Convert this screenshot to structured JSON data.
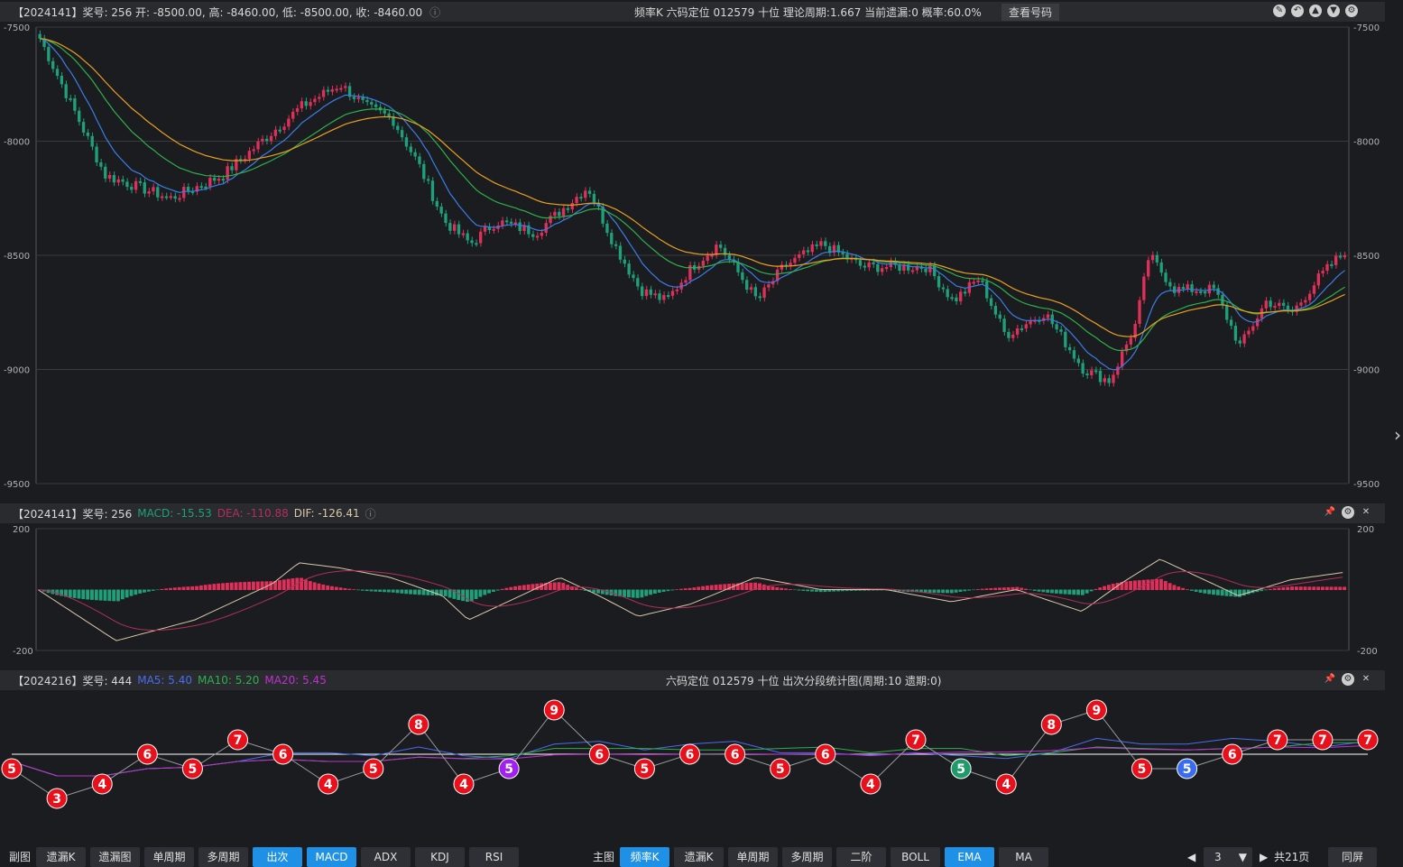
{
  "main_header": {
    "info": "【2024141】奖号: 256   开: -8500.00, 高: -8460.00, 低: -8500.00, 收: -8460.00",
    "center": "频率K   六码定位   012579   十位   理论周期:1.667   当前遗漏:0   概率:60.0%",
    "button": "查看号码"
  },
  "main_axis": {
    "labels": [
      "-7500",
      "-8000",
      "-8500",
      "-9000",
      "-9500"
    ]
  },
  "macd_header": {
    "prefix": "【2024141】奖号: 256",
    "macd": "MACD: -15.53",
    "dea": "DEA: -110.88",
    "dif": "DIF: -126.41"
  },
  "macd_axis": {
    "top": "200",
    "bottom": "-200"
  },
  "stat_header": {
    "prefix": "【2024216】奖号: 444",
    "ma5": "MA5: 5.40",
    "ma10": "MA10: 5.20",
    "ma20": "MA20: 5.45",
    "center": "六码定位   012579     十位   出次分段统计图(周期:10   遗期:0)"
  },
  "stat_points": [
    {
      "v": 5,
      "c": "red"
    },
    {
      "v": 3,
      "c": "red"
    },
    {
      "v": 4,
      "c": "red"
    },
    {
      "v": 6,
      "c": "red"
    },
    {
      "v": 5,
      "c": "red"
    },
    {
      "v": 7,
      "c": "red"
    },
    {
      "v": 6,
      "c": "red"
    },
    {
      "v": 4,
      "c": "red"
    },
    {
      "v": 5,
      "c": "red"
    },
    {
      "v": 8,
      "c": "red"
    },
    {
      "v": 4,
      "c": "red"
    },
    {
      "v": 5,
      "c": "purple"
    },
    {
      "v": 9,
      "c": "red"
    },
    {
      "v": 6,
      "c": "red"
    },
    {
      "v": 5,
      "c": "red"
    },
    {
      "v": 6,
      "c": "red"
    },
    {
      "v": 6,
      "c": "red"
    },
    {
      "v": 5,
      "c": "red"
    },
    {
      "v": 6,
      "c": "red"
    },
    {
      "v": 4,
      "c": "red"
    },
    {
      "v": 7,
      "c": "red"
    },
    {
      "v": 5,
      "c": "green"
    },
    {
      "v": 4,
      "c": "red"
    },
    {
      "v": 8,
      "c": "red"
    },
    {
      "v": 9,
      "c": "red"
    },
    {
      "v": 5,
      "c": "red"
    },
    {
      "v": 5,
      "c": "blue"
    },
    {
      "v": 6,
      "c": "red"
    },
    {
      "v": 7,
      "c": "red"
    },
    {
      "v": 7,
      "c": "red"
    },
    {
      "v": 7,
      "c": "red"
    }
  ],
  "colors": {
    "red": "#e8101a",
    "purple": "#a020f0",
    "green": "#1f9a6a",
    "blue": "#3a6cf0",
    "up": "#e0305a",
    "down": "#1fa07a",
    "ma_blue": "#3a7ee8",
    "ma_green": "#2fb04a",
    "ma_orange": "#e8a020"
  },
  "toolbar_left": {
    "label": "副图",
    "buttons": [
      "遗漏K",
      "遗漏图",
      "单周期",
      "多周期",
      "出次",
      "MACD",
      "ADX",
      "KDJ",
      "RSI"
    ],
    "active": [
      "出次",
      "MACD"
    ]
  },
  "toolbar_mid": {
    "label": "主图",
    "buttons": [
      "频率K",
      "遗漏K",
      "单周期",
      "多周期",
      "二阶",
      "BOLL",
      "EMA",
      "MA"
    ],
    "active": [
      "频率K",
      "EMA"
    ]
  },
  "pager": {
    "page": "3",
    "total": "共21页",
    "fullscreen": "同屏"
  }
}
